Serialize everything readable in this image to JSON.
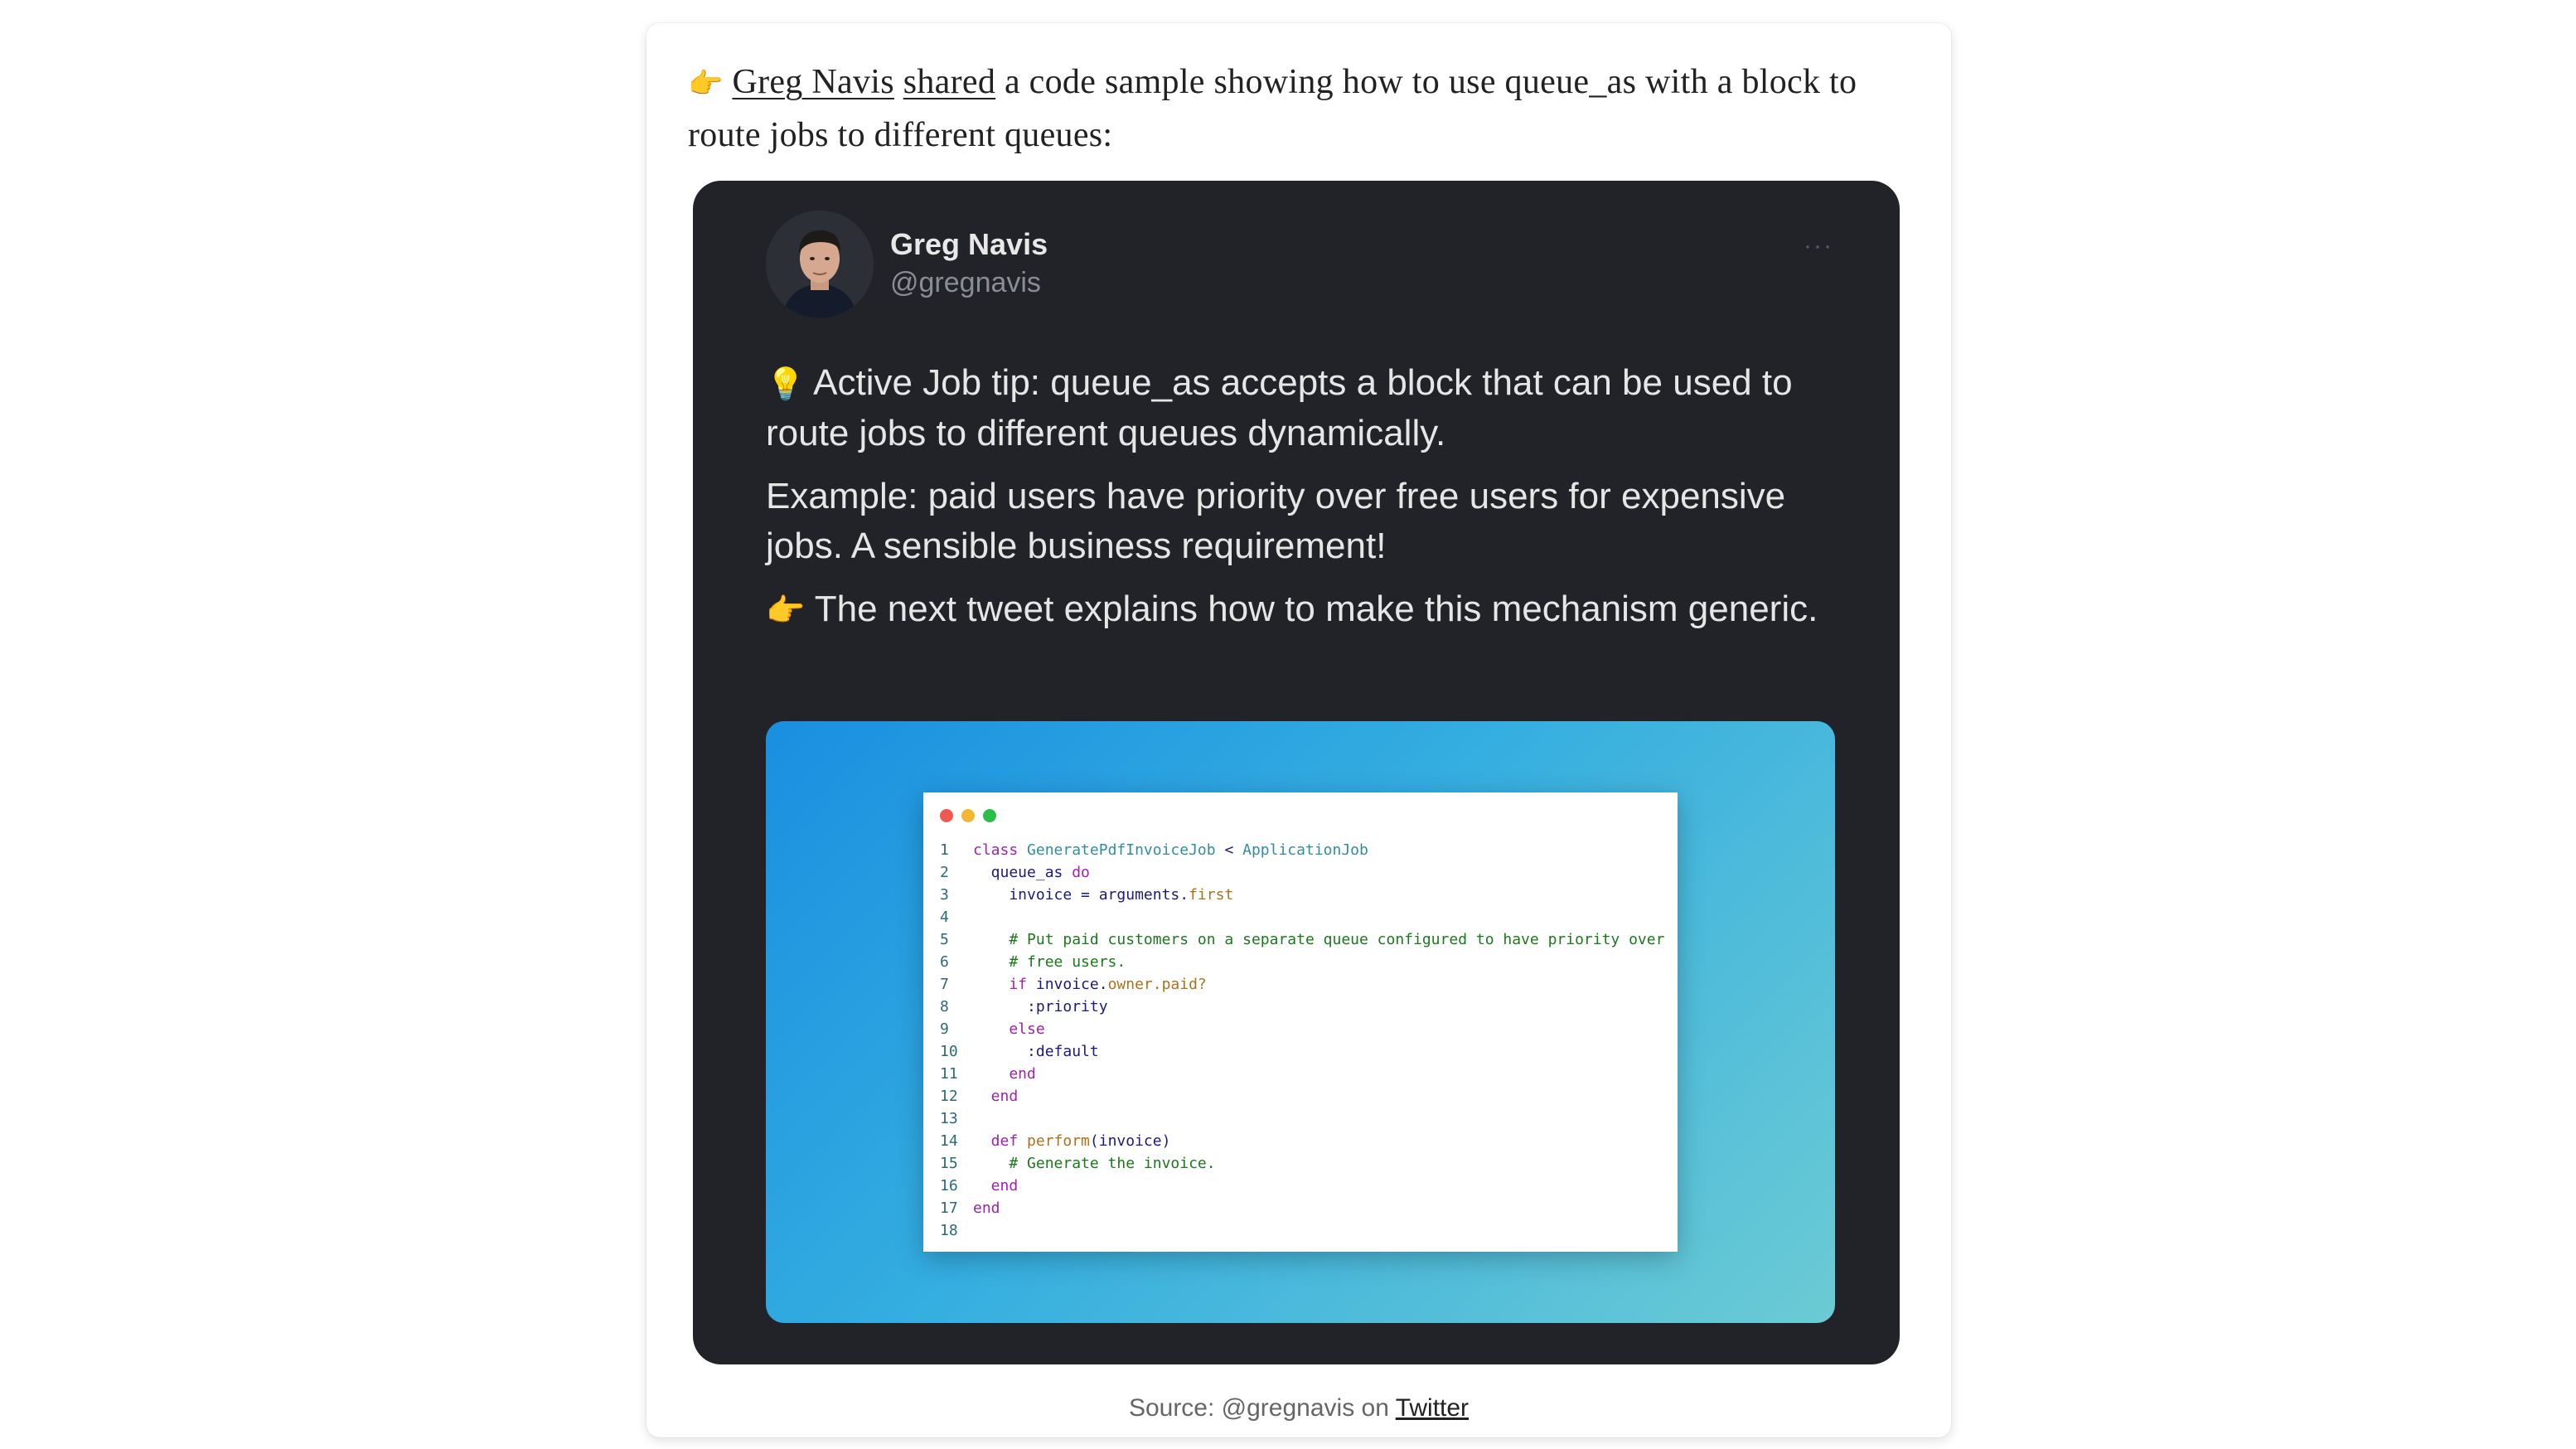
{
  "intro": {
    "pointer_emoji": "👉",
    "author_link": "Greg Navis",
    "shared_link": "shared",
    "text_after": " a code sample showing how to use queue_as with a block to route jobs to different queues:"
  },
  "tweet": {
    "author_name": "Greg Navis",
    "author_handle": "@gregnavis",
    "more_label": "···",
    "p1_emoji": "💡",
    "p1_text": " Active Job tip: queue_as accepts a block that can be used to route jobs to different queues dynamically.",
    "p2_text": "Example: paid users have priority over free users for expensive jobs. A sensible business requirement!",
    "p3_emoji": "👉",
    "p3_text": " The next tweet explains how to make this mechanism generic."
  },
  "code": {
    "lines": [
      {
        "n": "1",
        "parts": [
          [
            "kw",
            "class "
          ],
          [
            "cls",
            "GeneratePdfInvoiceJob"
          ],
          [
            "id",
            " < "
          ],
          [
            "cls",
            "ApplicationJob"
          ]
        ]
      },
      {
        "n": "2",
        "parts": [
          [
            "id",
            "  queue_as "
          ],
          [
            "kw",
            "do"
          ]
        ]
      },
      {
        "n": "3",
        "parts": [
          [
            "id",
            "    invoice = arguments."
          ],
          [
            "mt",
            "first"
          ]
        ]
      },
      {
        "n": "4",
        "parts": []
      },
      {
        "n": "5",
        "parts": [
          [
            "cm",
            "    # Put paid customers on a separate queue configured to have priority over"
          ]
        ]
      },
      {
        "n": "6",
        "parts": [
          [
            "cm",
            "    # free users."
          ]
        ]
      },
      {
        "n": "7",
        "parts": [
          [
            "kw",
            "    if "
          ],
          [
            "id",
            "invoice."
          ],
          [
            "mt",
            "owner.paid?"
          ]
        ]
      },
      {
        "n": "8",
        "parts": [
          [
            "sym",
            "      :priority"
          ]
        ]
      },
      {
        "n": "9",
        "parts": [
          [
            "kw",
            "    else"
          ]
        ]
      },
      {
        "n": "10",
        "parts": [
          [
            "sym",
            "      :default"
          ]
        ]
      },
      {
        "n": "11",
        "parts": [
          [
            "kw",
            "    end"
          ]
        ]
      },
      {
        "n": "12",
        "parts": [
          [
            "kw",
            "  end"
          ]
        ]
      },
      {
        "n": "13",
        "parts": []
      },
      {
        "n": "14",
        "parts": [
          [
            "kw",
            "  def "
          ],
          [
            "mt",
            "perform"
          ],
          [
            "id",
            "(invoice)"
          ]
        ]
      },
      {
        "n": "15",
        "parts": [
          [
            "cm",
            "    # Generate the invoice."
          ]
        ]
      },
      {
        "n": "16",
        "parts": [
          [
            "kw",
            "  end"
          ]
        ]
      },
      {
        "n": "17",
        "parts": [
          [
            "kw",
            "end"
          ]
        ]
      },
      {
        "n": "18",
        "parts": []
      }
    ],
    "dot_colors": [
      "#ee5a52",
      "#f2b632",
      "#2bbf4a"
    ]
  },
  "caption": {
    "prefix": "Source: @gregnavis on ",
    "link": "Twitter"
  }
}
